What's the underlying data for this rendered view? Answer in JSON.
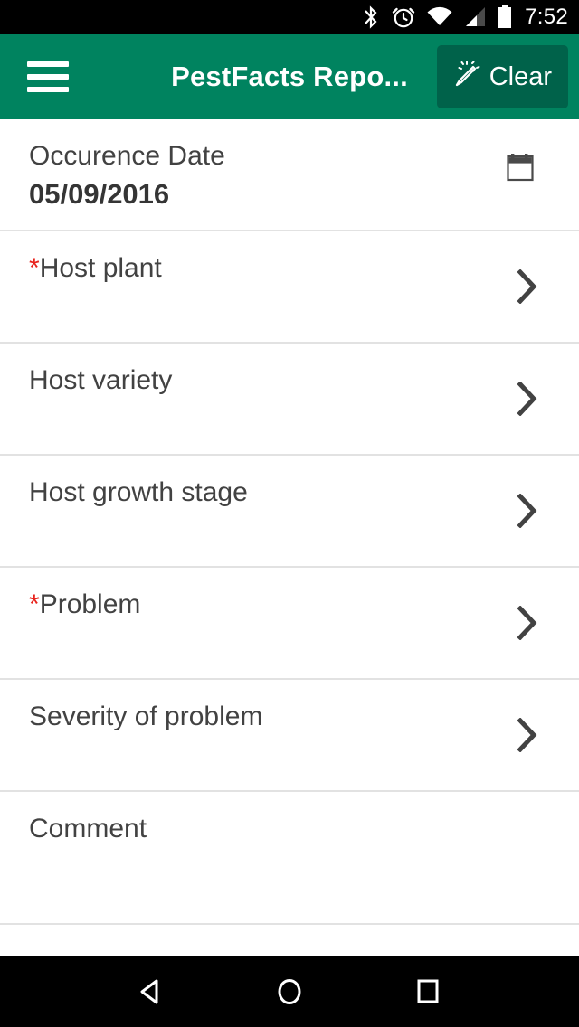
{
  "status_bar": {
    "time": "7:52",
    "icons": [
      "bluetooth-icon",
      "alarm-icon",
      "wifi-icon",
      "cellular-signal-icon",
      "battery-icon"
    ]
  },
  "app_bar": {
    "menu_icon": "hamburger-menu-icon",
    "title": "PestFacts Repo...",
    "clear_button": {
      "label": "Clear",
      "icon": "magic-wand-icon"
    },
    "background_color": "#00835f",
    "button_color": "#00624a"
  },
  "form": {
    "required_marker": "*",
    "rows": [
      {
        "name": "occurrence-date",
        "label": "Occurence Date",
        "value": "05/09/2016",
        "required": false,
        "accessory": "calendar-icon"
      },
      {
        "name": "host-plant",
        "label": "Host plant",
        "value": "",
        "required": true,
        "accessory": "chevron-right-icon"
      },
      {
        "name": "host-variety",
        "label": "Host variety",
        "value": "",
        "required": false,
        "accessory": "chevron-right-icon"
      },
      {
        "name": "host-growth-stage",
        "label": "Host growth stage",
        "value": "",
        "required": false,
        "accessory": "chevron-right-icon"
      },
      {
        "name": "problem",
        "label": "Problem",
        "value": "",
        "required": true,
        "accessory": "chevron-right-icon"
      },
      {
        "name": "severity-of-problem",
        "label": "Severity of problem",
        "value": "",
        "required": false,
        "accessory": "chevron-right-icon"
      },
      {
        "name": "comment",
        "label": "Comment",
        "value": "",
        "required": false,
        "accessory": "none"
      }
    ],
    "label_color": "#424242",
    "required_color": "#e8221c",
    "divider_color": "#e2e2e2"
  },
  "nav_bar": {
    "back": "back-triangle-icon",
    "home": "home-circle-icon",
    "recents": "recents-square-icon"
  }
}
